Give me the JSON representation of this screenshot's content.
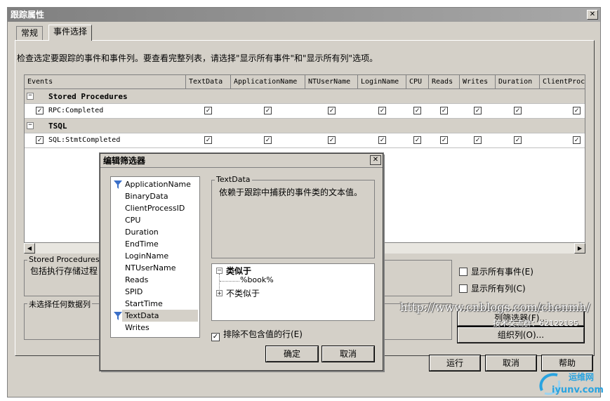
{
  "window": {
    "title": "跟踪属性"
  },
  "tabs": [
    {
      "label": "常规"
    },
    {
      "label": "事件选择"
    }
  ],
  "instruction": "检查选定要跟踪的事件和事件列。要查看完整列表，请选择\"显示所有事件\"和\"显示所有列\"选项。",
  "grid": {
    "columns": [
      "Events",
      "TextData",
      "ApplicationName",
      "NTUserName",
      "LoginName",
      "CPU",
      "Reads",
      "Writes",
      "Duration",
      "ClientProc"
    ],
    "groups": [
      {
        "name": "Stored Procedures",
        "events": [
          {
            "name": "RPC:Completed"
          }
        ]
      },
      {
        "name": "TSQL",
        "events": [
          {
            "name": "SQL:StmtCompleted"
          }
        ]
      }
    ]
  },
  "stored_proc_box": {
    "legend": "Stored Procedures",
    "text": "包括执行存储过程"
  },
  "no_column_box": {
    "legend": "未选择任何数据列"
  },
  "options": {
    "show_all_events": "显示所有事件(E)",
    "show_all_columns": "显示所有列(C)"
  },
  "buttons": {
    "column_filter": "列筛选器(F)...",
    "organize_columns": "组织列(O)...",
    "run": "运行",
    "cancel": "取消",
    "help": "帮助"
  },
  "filter_dialog": {
    "title": "编辑筛选器",
    "columns": [
      "ApplicationName",
      "BinaryData",
      "ClientProcessID",
      "CPU",
      "Duration",
      "EndTime",
      "LoginName",
      "NTUserName",
      "Reads",
      "SPID",
      "StartTime",
      "TextData",
      "Writes"
    ],
    "description_legend": "TextData",
    "description": "依赖于跟踪中捕获的事件类的文本值。",
    "tree": {
      "like_label": "类似于",
      "like_value": "%book%",
      "not_like_label": "不类似于"
    },
    "exclude_nulls": "排除不包含值的行(E)",
    "ok": "确定",
    "cancel": "取消"
  },
  "watermark": {
    "url": "http://www.cnblogs.com/chenmh/",
    "qq": "技术交流群：62122135"
  },
  "logo": {
    "text_cn": "运维网",
    "text_en": "iyunv.com"
  }
}
